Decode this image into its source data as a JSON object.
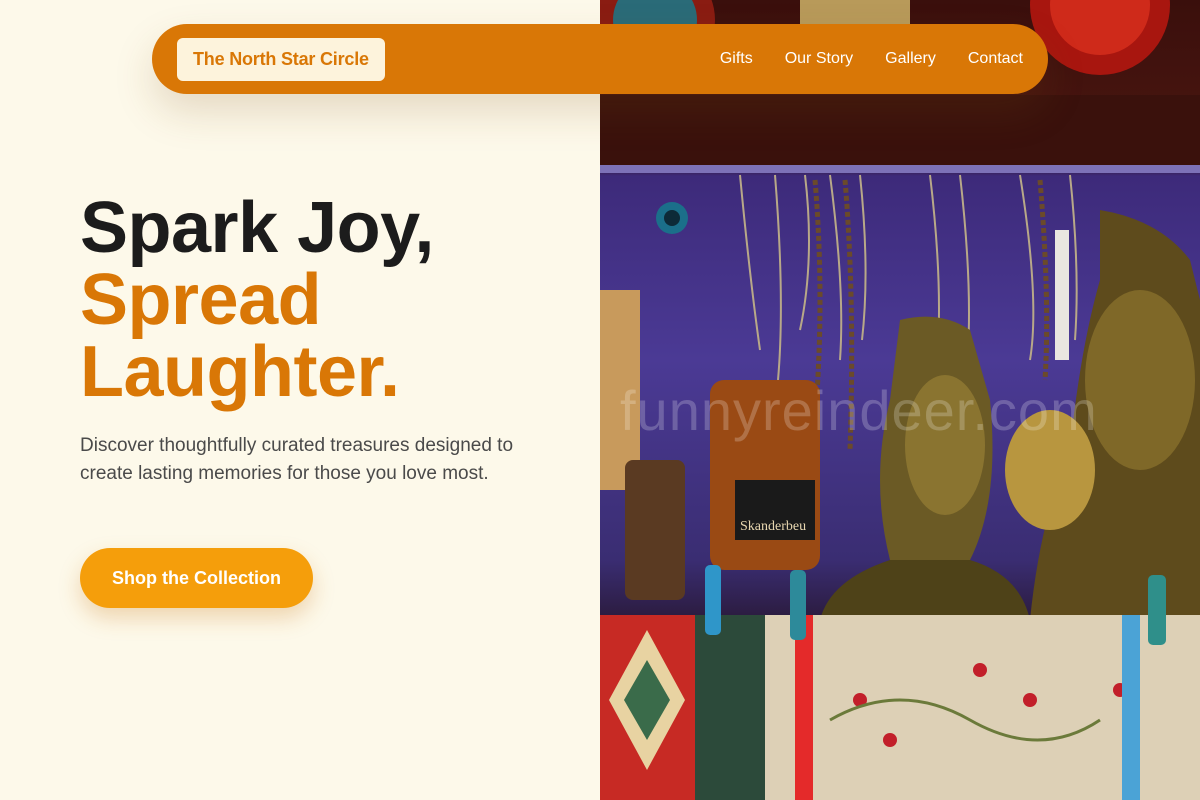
{
  "nav": {
    "brand": "The North Star Circle",
    "links": [
      "Gifts",
      "Our Story",
      "Gallery",
      "Contact"
    ]
  },
  "hero": {
    "title_line1": "Spark Joy,",
    "title_line2": "Spread",
    "title_line3": "Laughter.",
    "description": "Discover thoughtfully curated treasures designed to create lasting memories for those you love most.",
    "cta_label": "Shop the Collection"
  },
  "photo": {
    "watermark": "funnyreindeer.com",
    "bottle_label": "Skanderbeu"
  },
  "colors": {
    "accent": "#d97706",
    "cta": "#f59e0b",
    "background": "#fdf9ea",
    "brand_chip": "#fdf3dc"
  }
}
